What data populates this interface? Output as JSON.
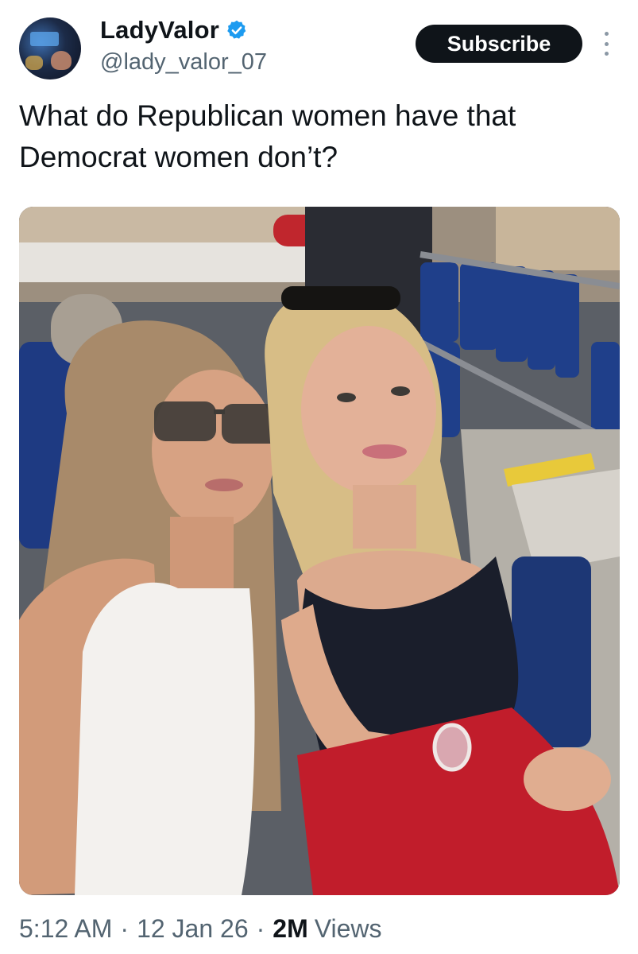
{
  "author": {
    "display_name": "LadyValor",
    "handle": "@lady_valor_07",
    "verified": true
  },
  "actions": {
    "subscribe_label": "Subscribe"
  },
  "tweet": {
    "text_line1": "What do Republican women have that",
    "text_line2": "Democrat women don’t?"
  },
  "meta": {
    "time": "5:12 AM",
    "separator": "·",
    "date": "12 Jan 26",
    "views_count": "2M",
    "views_label": "Views"
  },
  "colors": {
    "verified_blue": "#1d9bf0",
    "subscribe_bg": "#0f1419",
    "secondary_text": "#536471"
  },
  "icons": {
    "verified": "verified-badge-icon",
    "more": "more-dots-icon"
  }
}
